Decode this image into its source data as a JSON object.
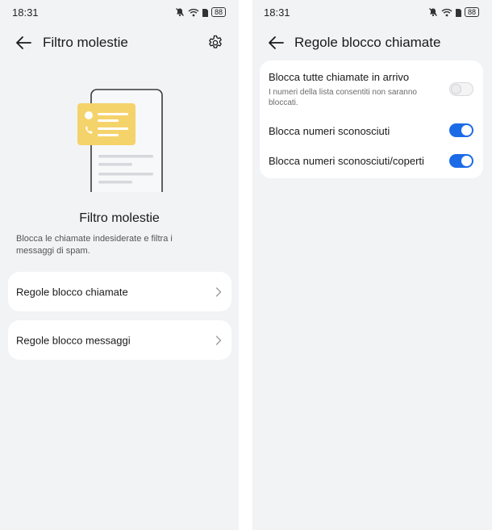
{
  "left_screen": {
    "status_bar": {
      "time": "18:31",
      "battery": "88"
    },
    "app_bar": {
      "title": "Filtro molestie"
    },
    "hero": {
      "title": "Filtro molestie",
      "description": "Blocca le chiamate indesiderate e filtra i messaggi di spam."
    },
    "menu": [
      {
        "label": "Regole blocco chiamate"
      },
      {
        "label": "Regole blocco messaggi"
      }
    ]
  },
  "right_screen": {
    "status_bar": {
      "time": "18:31",
      "battery": "88"
    },
    "app_bar": {
      "title": "Regole blocco chiamate"
    },
    "settings": [
      {
        "title": "Blocca tutte chiamate in arrivo",
        "subtitle": "I numeri della lista consentiti non saranno bloccati.",
        "enabled": false
      },
      {
        "title": "Blocca numeri sconosciuti",
        "enabled": true
      },
      {
        "title": "Blocca numeri sconosciuti/coperti",
        "enabled": true
      }
    ]
  },
  "colors": {
    "accent": "#1b6be6",
    "background": "#f1f3f5",
    "card": "#ffffff",
    "illustration_yellow": "#f5d36b"
  },
  "icons": [
    "back-arrow-icon",
    "gear-icon",
    "chevron-right-icon",
    "bell-off-icon",
    "wifi-icon",
    "sim-icon",
    "battery-icon"
  ]
}
